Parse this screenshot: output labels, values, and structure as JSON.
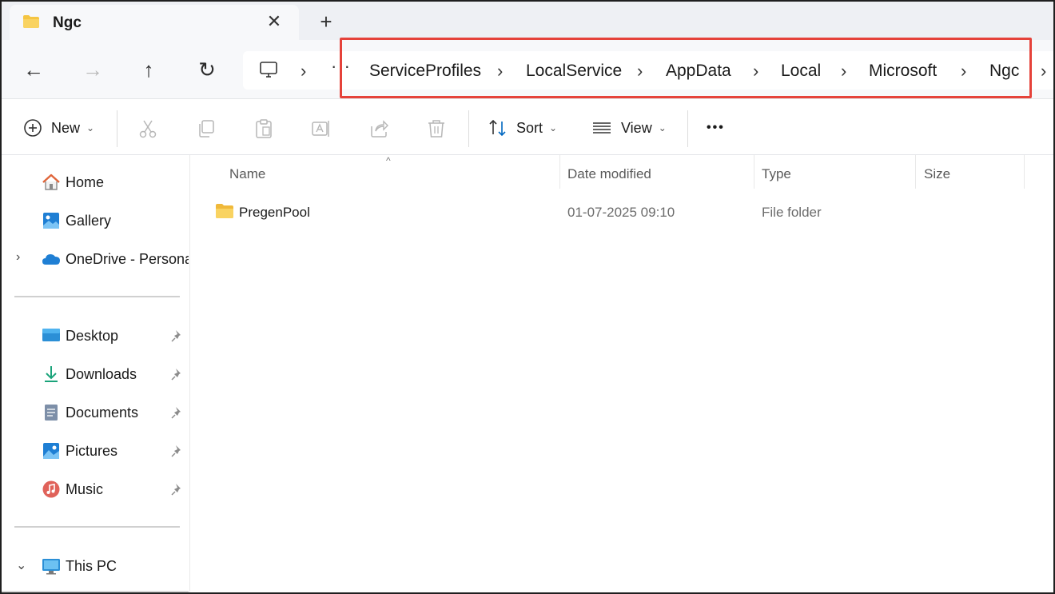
{
  "tab": {
    "title": "Ngc",
    "close": "✕",
    "new": "+"
  },
  "nav": {
    "back": "←",
    "forward": "→",
    "up": "↑",
    "refresh": "↻"
  },
  "breadcrumb": {
    "more": "···",
    "separator": "›",
    "items": [
      "ServiceProfiles",
      "LocalService",
      "AppData",
      "Local",
      "Microsoft",
      "Ngc"
    ]
  },
  "commands": {
    "new_label": "New",
    "sort_label": "Sort",
    "view_label": "View",
    "more_label": "•••",
    "chevron": "⌄"
  },
  "sidebar": {
    "items": [
      {
        "label": "Home",
        "icon": "home-icon"
      },
      {
        "label": "Gallery",
        "icon": "gallery-icon"
      },
      {
        "label": "OneDrive - Personal",
        "icon": "onedrive-icon",
        "expander": "›"
      },
      {
        "label": "Desktop",
        "icon": "desktop-icon",
        "pinned": true
      },
      {
        "label": "Downloads",
        "icon": "downloads-icon",
        "pinned": true
      },
      {
        "label": "Documents",
        "icon": "documents-icon",
        "pinned": true
      },
      {
        "label": "Pictures",
        "icon": "pictures-icon",
        "pinned": true
      },
      {
        "label": "Music",
        "icon": "music-icon",
        "pinned": true
      },
      {
        "label": "This PC",
        "icon": "this-pc-icon",
        "expander": "⌄"
      }
    ]
  },
  "columns": {
    "name": "Name",
    "date": "Date modified",
    "type": "Type",
    "size": "Size",
    "sort_caret": "^"
  },
  "files": [
    {
      "name": "PregenPool",
      "date": "01-07-2025 09:10",
      "type": "File folder",
      "size": ""
    }
  ],
  "colors": {
    "highlight": "#e5423a",
    "folder": "#f5c542",
    "accent": "#0067c0"
  }
}
